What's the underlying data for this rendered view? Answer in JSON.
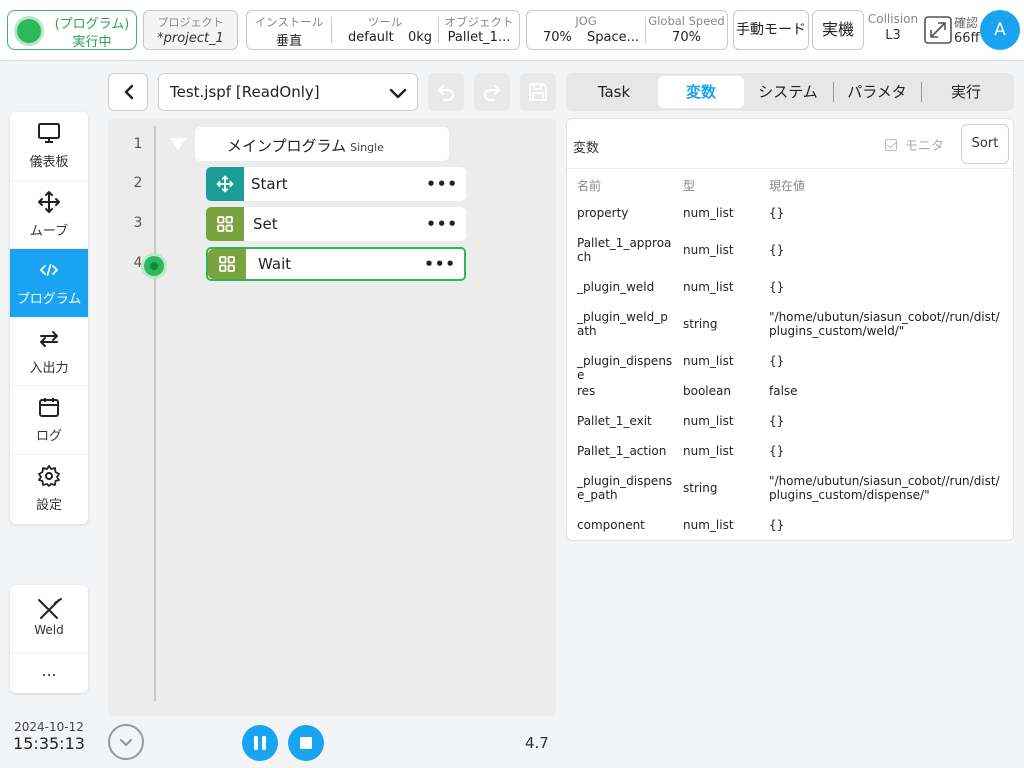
{
  "status": {
    "line1": "(プログラム)",
    "line2": "実行中"
  },
  "project": {
    "label": "プロジェクト",
    "value": "*project_1"
  },
  "install": {
    "label": "インストール",
    "value": "垂直"
  },
  "tool": {
    "label": "ツール",
    "name": "default",
    "weight": "0kg"
  },
  "object": {
    "label": "オブジェクト",
    "value": "Pallet_1..."
  },
  "jog": {
    "label": "JOG",
    "value": "70%",
    "space": "Space..."
  },
  "global_speed": {
    "label": "Global Speed",
    "value": "70%"
  },
  "mode_button": "手動モード",
  "real_button": "実機",
  "collision": {
    "label": "Collision",
    "value": "L3"
  },
  "confirm": {
    "label": "確認",
    "value": "66ff"
  },
  "avatar": "A",
  "sidebar": {
    "items": [
      {
        "label": "儀表板",
        "icon": "monitor-icon"
      },
      {
        "label": "ムーブ",
        "icon": "move-icon"
      },
      {
        "label": "プログラム",
        "icon": "code-icon",
        "active": true
      },
      {
        "label": "入出力",
        "icon": "io-icon"
      },
      {
        "label": "ログ",
        "icon": "calendar-icon"
      },
      {
        "label": "設定",
        "icon": "gear-icon"
      }
    ],
    "weld": "Weld",
    "more": "..."
  },
  "datetime": {
    "date": "2024-10-12",
    "time": "15:35:13"
  },
  "file": {
    "name": "Test.jspf [ReadOnly]"
  },
  "tree": {
    "line_numbers": [
      "1",
      "2",
      "3",
      "4"
    ],
    "main": {
      "label": "メインプログラム",
      "sub": "Single"
    },
    "nodes": [
      {
        "label": "Start",
        "color": "#1a9e96",
        "icon": "move-icon"
      },
      {
        "label": "Set",
        "color": "#7ba23f",
        "icon": "grid-icon"
      },
      {
        "label": "Wait",
        "color": "#7ba23f",
        "icon": "grid-icon",
        "selected": true
      }
    ]
  },
  "version": "4.7",
  "tabs": [
    {
      "label": "Task"
    },
    {
      "label": "変数",
      "active": true
    },
    {
      "label": "システム"
    },
    {
      "label": "パラメタ"
    },
    {
      "label": "実行"
    }
  ],
  "variables": {
    "title": "変数",
    "monitor_label": "モニタ",
    "sort_label": "Sort",
    "headers": [
      "名前",
      "型",
      "現在値"
    ],
    "rows": [
      {
        "name": "property",
        "type": "num_list",
        "value": "{}"
      },
      {
        "name": "Pallet_1_approach",
        "type": "num_list",
        "value": "{}"
      },
      {
        "name": "_plugin_weld",
        "type": "num_list",
        "value": "{}"
      },
      {
        "name": "_plugin_weld_path",
        "type": "string",
        "value": "\"/home/ubutun/siasun_cobot//run/dist/plugins_custom/weld/\""
      },
      {
        "name": "_plugin_dispense",
        "type": "num_list",
        "value": "{}"
      },
      {
        "name": "res",
        "type": "boolean",
        "value": "false"
      },
      {
        "name": "Pallet_1_exit",
        "type": "num_list",
        "value": "{}"
      },
      {
        "name": "Pallet_1_action",
        "type": "num_list",
        "value": "{}"
      },
      {
        "name": "_plugin_dispense_path",
        "type": "string",
        "value": "\"/home/ubutun/siasun_cobot//run/dist/plugins_custom/dispense/\""
      },
      {
        "name": "component",
        "type": "num_list",
        "value": "{}"
      }
    ]
  },
  "colors": {
    "accent": "#1aa3f0",
    "running": "#2eb85c",
    "teal": "#1a9e96",
    "olive": "#7ba23f"
  }
}
